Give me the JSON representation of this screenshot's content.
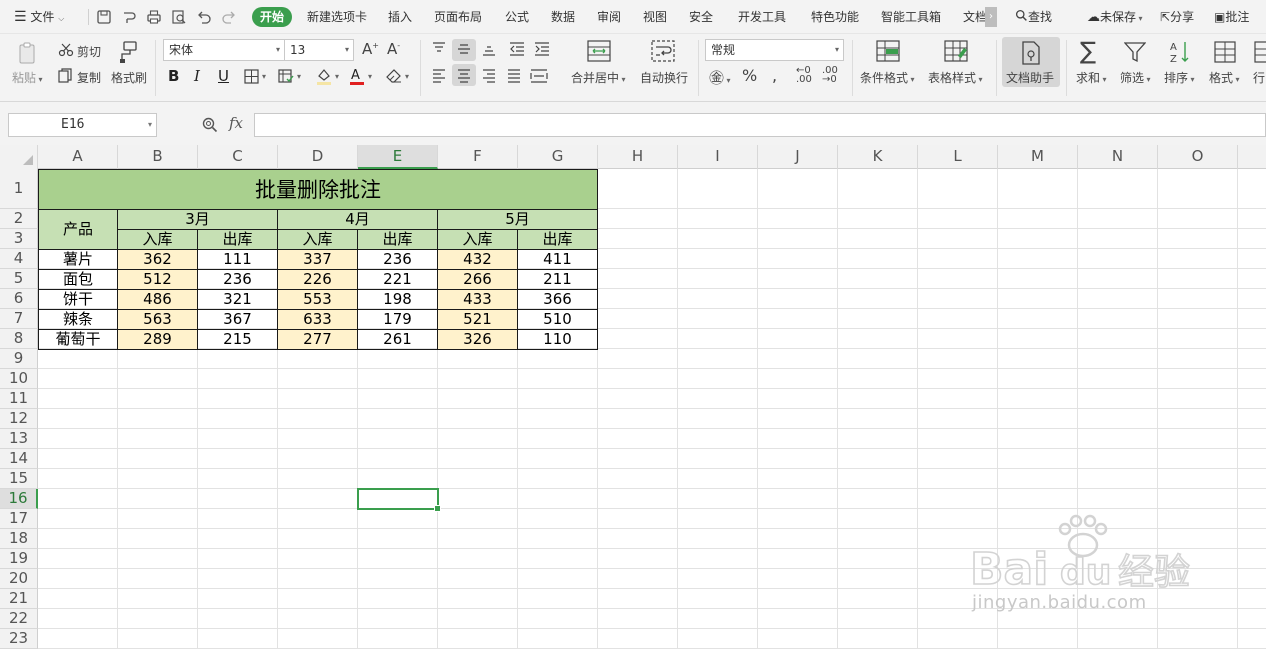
{
  "menubar": {
    "file_label": "文件",
    "tabs": [
      {
        "label": "开始",
        "active": true
      },
      {
        "label": "新建选项卡"
      },
      {
        "label": "插入"
      },
      {
        "label": "页面布局"
      },
      {
        "label": "公式"
      },
      {
        "label": "数据"
      },
      {
        "label": "审阅"
      },
      {
        "label": "视图"
      },
      {
        "label": "安全"
      },
      {
        "label": "开发工具"
      },
      {
        "label": "特色功能"
      },
      {
        "label": "智能工具箱"
      },
      {
        "label": "文档"
      }
    ],
    "search_label": "查找",
    "unsaved_label": "未保存",
    "share_label": "分享",
    "comment_label": "批注"
  },
  "ribbon": {
    "paste_label": "粘贴",
    "cut_label": "剪切",
    "copy_label": "复制",
    "format_painter_label": "格式刷",
    "font_name": "宋体",
    "font_size": "13",
    "bold": "B",
    "italic": "I",
    "underline": "U",
    "merge_center_label": "合并居中",
    "wrap_text_label": "自动换行",
    "number_format": "常规",
    "percent": "%",
    "conditional_format_label": "条件格式",
    "table_style_label": "表格样式",
    "doc_assistant_label": "文档助手",
    "sum_label": "求和",
    "filter_label": "筛选",
    "sort_label": "排序",
    "format_label": "格式",
    "rowcol_label": "行"
  },
  "formula": {
    "name_box": "E16",
    "fx": "fx",
    "value": ""
  },
  "columns": [
    "A",
    "B",
    "C",
    "D",
    "E",
    "F",
    "G",
    "H",
    "I",
    "J",
    "K",
    "L",
    "M",
    "N",
    "O"
  ],
  "rows": [
    "1",
    "2",
    "3",
    "4",
    "5",
    "6",
    "7",
    "8",
    "9",
    "10",
    "11",
    "12",
    "13",
    "14",
    "15",
    "16",
    "17",
    "18",
    "19",
    "20",
    "21",
    "22",
    "23"
  ],
  "selected_cell": "E16",
  "table": {
    "title": "批量删除批注",
    "product_header": "产品",
    "months": [
      "3月",
      "4月",
      "5月"
    ],
    "sub_headers": [
      "入库",
      "出库",
      "入库",
      "出库",
      "入库",
      "出库"
    ],
    "rows": [
      {
        "product": "薯片",
        "values": [
          "362",
          "111",
          "337",
          "236",
          "432",
          "411"
        ]
      },
      {
        "product": "面包",
        "values": [
          "512",
          "236",
          "226",
          "221",
          "266",
          "211"
        ]
      },
      {
        "product": "饼干",
        "values": [
          "486",
          "321",
          "553",
          "198",
          "433",
          "366"
        ]
      },
      {
        "product": "辣条",
        "values": [
          "563",
          "367",
          "633",
          "179",
          "521",
          "510"
        ]
      },
      {
        "product": "葡萄干",
        "values": [
          "289",
          "215",
          "277",
          "261",
          "326",
          "110"
        ]
      }
    ]
  },
  "colors": {
    "accent": "#3a9e4d",
    "title_fill": "#a9d08e",
    "header_fill": "#c6e0b4",
    "in_fill": "#fff2cc"
  },
  "watermark": {
    "url": "jingyan.baidu.com"
  }
}
